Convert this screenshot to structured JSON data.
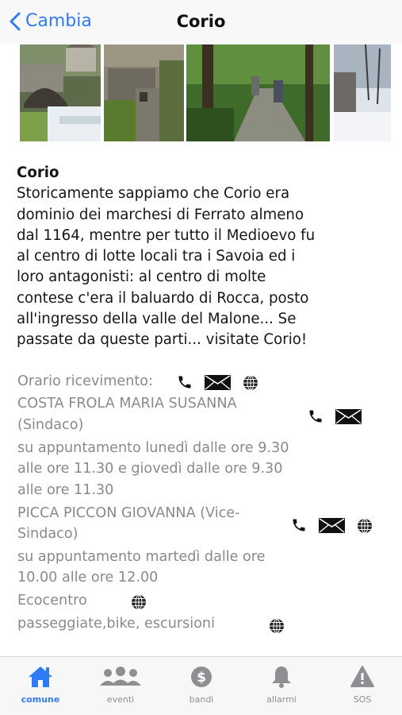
{
  "navbar": {
    "back_label": "Cambia",
    "title": "Corio"
  },
  "description": {
    "title": "Corio",
    "lines": [
      "Storicamente sappiamo che Corio era",
      "dominio dei marchesi di Ferrato almeno",
      "dal 1164, mentre per tutto il Medioevo fu",
      "al centro di lotte locali tra i Savoia ed i",
      "loro antagonisti: al centro di molte",
      "contese c'era il baluardo di Rocca, posto",
      "all'ingresso della valle del Malone... Se",
      "passate da queste parti... visitate Corio!"
    ]
  },
  "info": {
    "orario_label": "Orario ricevimento:",
    "sindaco": {
      "name": "COSTA FROLA MARIA SUSANNA",
      "role": "(Sindaco)"
    },
    "sindaco_hours": [
      "su appuntamento lunedì dalle ore 9.30",
      "alle ore 11.30 e giovedì dalle ore 9.30",
      "alle ore 11.30"
    ],
    "vice": {
      "name": "PICCA PICCON GIOVANNA (Vice-",
      "role": "Sindaco)"
    },
    "vice_hours": [
      "su appuntamento martedì dalle ore",
      "10.00 alle ore 12.00"
    ],
    "ecocentro": "Ecocentro",
    "passeggiate": "passeggiate,bike, escursioni"
  },
  "tabs": [
    {
      "label": "comune",
      "icon": "home-icon",
      "active": true
    },
    {
      "label": "eventi",
      "icon": "people-icon",
      "active": false
    },
    {
      "label": "bandi",
      "icon": "dollar-icon",
      "active": false
    },
    {
      "label": "allarmi",
      "icon": "bell-icon",
      "active": false
    },
    {
      "label": "SOS",
      "icon": "warning-icon",
      "active": false
    }
  ],
  "colors": {
    "accent": "#2f7bf5",
    "inactive": "#8e8e93",
    "info_text": "#8a8a8a"
  }
}
